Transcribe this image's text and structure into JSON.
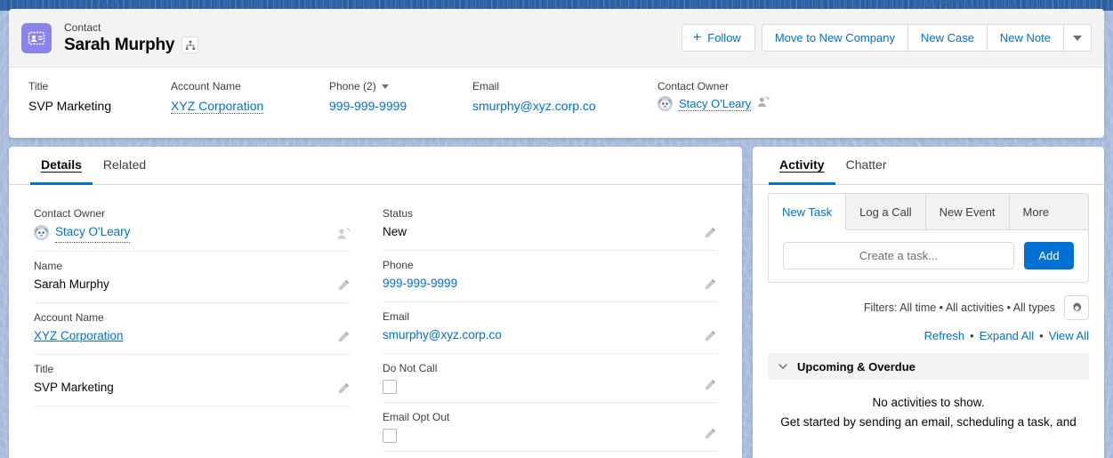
{
  "header": {
    "object_type": "Contact",
    "record_name": "Sarah Murphy",
    "object_icon": "contact-card-icon",
    "hierarchy_icon": "hierarchy-icon",
    "accent_color": "#0070d2",
    "object_icon_color": "#8a84e8",
    "actions": {
      "follow_label": "Follow",
      "follow_icon": "plus-icon",
      "move_label": "Move to New Company",
      "new_case_label": "New Case",
      "new_note_label": "New Note",
      "more_icon": "chevron-down-icon"
    }
  },
  "highlights": [
    {
      "label": "Title",
      "value": "SVP Marketing",
      "type": "text"
    },
    {
      "label": "Account Name",
      "value": "XYZ Corporation",
      "type": "link"
    },
    {
      "label": "Phone (2)",
      "value": "999-999-9999",
      "type": "link",
      "has_caret": true
    },
    {
      "label": "Email",
      "value": "smurphy@xyz.corp.co",
      "type": "link"
    },
    {
      "label": "Contact Owner",
      "value": "Stacy O'Leary",
      "type": "owner",
      "avatar": "user-avatar"
    }
  ],
  "details": {
    "tabs": [
      {
        "label": "Details",
        "active": true
      },
      {
        "label": "Related",
        "active": false
      }
    ],
    "left_fields": [
      {
        "label": "Contact Owner",
        "value": "Stacy O'Leary",
        "type": "owner",
        "edit_icon": "change-owner-icon"
      },
      {
        "label": "Name",
        "value": "Sarah Murphy",
        "type": "text",
        "edit_icon": "pencil-icon"
      },
      {
        "label": "Account Name",
        "value": "XYZ Corporation",
        "type": "link",
        "edit_icon": "pencil-icon"
      },
      {
        "label": "Title",
        "value": "SVP Marketing",
        "type": "text",
        "edit_icon": "pencil-icon"
      }
    ],
    "right_fields": [
      {
        "label": "Status",
        "value": "New",
        "type": "text",
        "edit_icon": "pencil-icon"
      },
      {
        "label": "Phone",
        "value": "999-999-9999",
        "type": "link",
        "edit_icon": "pencil-icon"
      },
      {
        "label": "Email",
        "value": "smurphy@xyz.corp.co",
        "type": "link",
        "edit_icon": "pencil-icon"
      },
      {
        "label": "Do Not Call",
        "value": "",
        "type": "checkbox",
        "checked": false,
        "edit_icon": "pencil-icon"
      },
      {
        "label": "Email Opt Out",
        "value": "",
        "type": "checkbox",
        "checked": false,
        "edit_icon": "pencil-icon"
      }
    ]
  },
  "activity": {
    "tabs": [
      {
        "label": "Activity",
        "active": true
      },
      {
        "label": "Chatter",
        "active": false
      }
    ],
    "composer": {
      "subtabs": [
        {
          "label": "New Task",
          "active": true
        },
        {
          "label": "Log a Call",
          "active": false
        },
        {
          "label": "New Event",
          "active": false
        },
        {
          "label": "More",
          "active": false
        }
      ],
      "input_placeholder": "Create a task...",
      "input_value": "",
      "add_label": "Add"
    },
    "filters_text": "Filters: All time • All activities • All types",
    "settings_icon": "gear-icon",
    "links": {
      "refresh": "Refresh",
      "sep1": "•",
      "expand_all": "Expand All",
      "sep2": "•",
      "view_all": "View All"
    },
    "section": {
      "title": "Upcoming & Overdue",
      "chevron_icon": "chevron-down-icon"
    },
    "empty_state": {
      "line1": "No activities to show.",
      "line2": "Get started by sending an email, scheduling a task, and"
    }
  }
}
